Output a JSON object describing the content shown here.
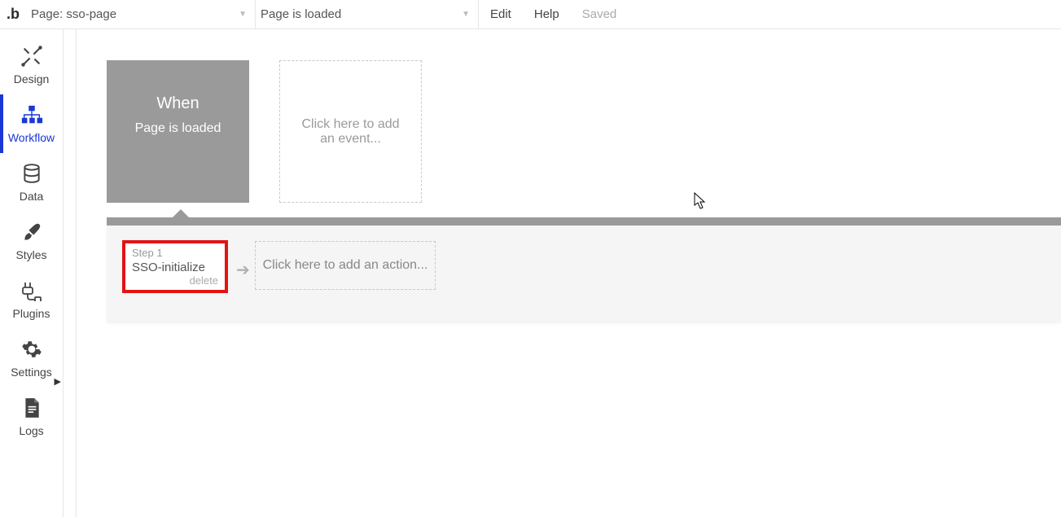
{
  "topbar": {
    "page_dropdown_label": "Page: sso-page",
    "event_dropdown_label": "Page is loaded",
    "menu": {
      "edit": "Edit",
      "help": "Help",
      "saved": "Saved"
    }
  },
  "sidenav": {
    "items": [
      {
        "label": "Design"
      },
      {
        "label": "Workflow"
      },
      {
        "label": "Data"
      },
      {
        "label": "Styles"
      },
      {
        "label": "Plugins"
      },
      {
        "label": "Settings"
      },
      {
        "label": "Logs"
      }
    ]
  },
  "event_block": {
    "when_label": "When",
    "event_name": "Page is loaded"
  },
  "add_event_placeholder": "Click here to add an event...",
  "action_step": {
    "step_label": "Step 1",
    "step_name": "SSO-initialize",
    "delete_label": "delete"
  },
  "add_action_placeholder": "Click here to add an action...",
  "colors": {
    "accent": "#1a37d6",
    "highlight_border": "#e11414"
  }
}
